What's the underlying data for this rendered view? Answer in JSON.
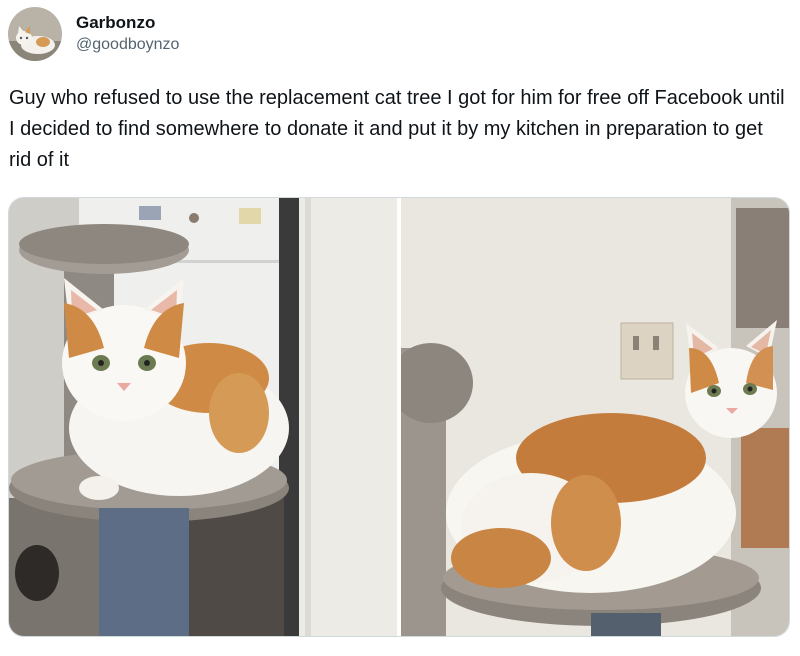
{
  "author": {
    "display_name": "Garbonzo",
    "handle": "@goodboynzo",
    "avatar_icon": "cat-avatar"
  },
  "tweet": {
    "text": "Guy who refused to use the replacement cat tree I got for him for free off Facebook until I decided to find somewhere to donate it and put it by my kitchen in preparation to get rid of it"
  },
  "media": {
    "photos": [
      {
        "subject": "orange-and-white cat lying on cat tree platform beside fridge"
      },
      {
        "subject": "orange-and-white cat lying on cat tree platform by kitchen wall"
      }
    ]
  },
  "colors": {
    "text": "#0f1419",
    "secondary_text": "#536471",
    "border": "#cfd9de"
  }
}
